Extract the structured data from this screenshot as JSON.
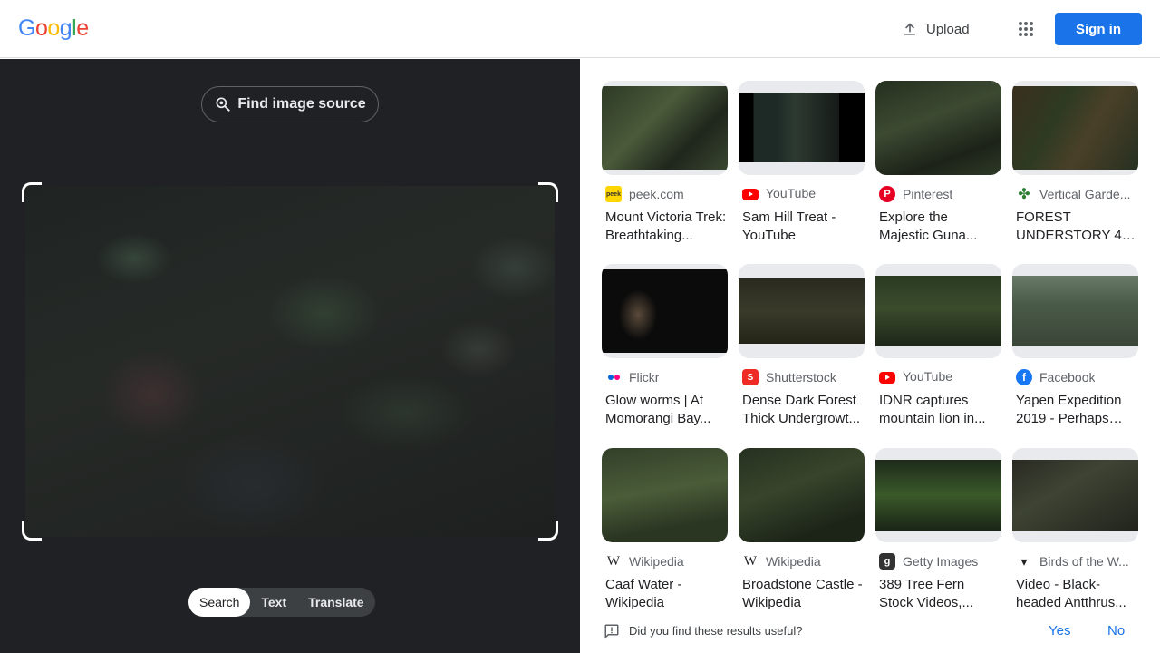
{
  "logo": {
    "letters": [
      "G",
      "o",
      "o",
      "g",
      "l",
      "e"
    ],
    "colors": [
      "#4285f4",
      "#ea4335",
      "#fbbc05",
      "#4285f4",
      "#34a853",
      "#ea4335"
    ]
  },
  "header": {
    "upload_label": "Upload",
    "signin_label": "Sign in",
    "accent": "#1a73e8"
  },
  "left": {
    "find_source_label": "Find image source",
    "modes": [
      "Search",
      "Text",
      "Translate"
    ],
    "active_mode": "Search"
  },
  "results": [
    {
      "source": "peek.com",
      "favicon": "peek-icon",
      "title": "Mount Victoria Trek: Breathtaking..."
    },
    {
      "source": "YouTube",
      "favicon": "youtube-icon",
      "title": "Sam Hill Treat - YouTube"
    },
    {
      "source": "Pinterest",
      "favicon": "pinterest-icon",
      "title": "Explore the Majestic Guna..."
    },
    {
      "source": "Vertical Garde...",
      "favicon": "leaf-icon",
      "title": "FOREST UNDERSTORY 4 |..."
    },
    {
      "source": "Flickr",
      "favicon": "flickr-icon",
      "title": "Glow worms | At Momorangi Bay..."
    },
    {
      "source": "Shutterstock",
      "favicon": "shutterstock-icon",
      "title": "Dense Dark Forest Thick Undergrowt..."
    },
    {
      "source": "YouTube",
      "favicon": "youtube-icon",
      "title": "IDNR captures mountain lion in..."
    },
    {
      "source": "Facebook",
      "favicon": "facebook-icon",
      "title": "Yapen Expedition 2019 - Perhaps ou..."
    },
    {
      "source": "Wikipedia",
      "favicon": "wikipedia-icon",
      "title": "Caaf Water - Wikipedia"
    },
    {
      "source": "Wikipedia",
      "favicon": "wikipedia-icon",
      "title": "Broadstone Castle - Wikipedia"
    },
    {
      "source": "Getty Images",
      "favicon": "getty-icon",
      "title": "389 Tree Fern Stock Videos,..."
    },
    {
      "source": "Birds of the W...",
      "favicon": "bird-icon",
      "title": "Video - Black-headed Antthrus..."
    }
  ],
  "feedback": {
    "question": "Did you find these results useful?",
    "yes": "Yes",
    "no": "No"
  }
}
